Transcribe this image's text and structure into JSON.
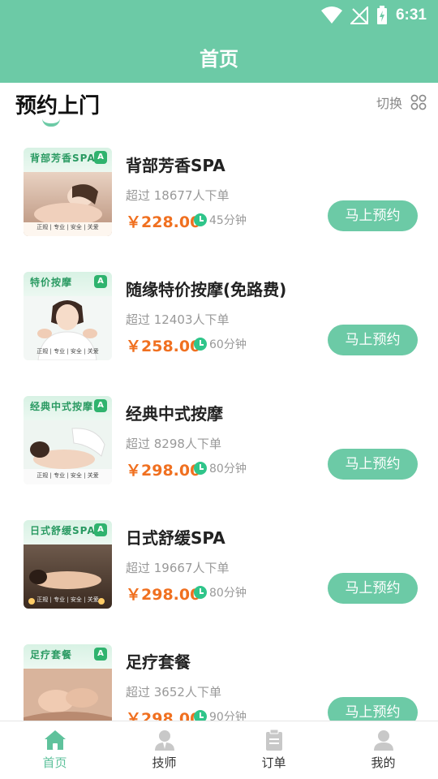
{
  "status_bar": {
    "time": "6:31"
  },
  "header": {
    "title": "首页"
  },
  "section": {
    "title": "预约上门",
    "switch_label": "切换"
  },
  "services": [
    {
      "name": "背部芳香SPA",
      "orders": "超过 18677人下单",
      "price": "￥228.00",
      "duration": "45分钟",
      "button": "马上预约",
      "thumb_title": "背部芳香SPA",
      "thumb_tags": "正规 | 专业 | 安全 | 关爱"
    },
    {
      "name": "随缘特价按摩(免路费)",
      "orders": "超过 12403人下单",
      "price": "￥258.00",
      "duration": "60分钟",
      "button": "马上预约",
      "thumb_title": "特价按摩",
      "thumb_tags": "正规 | 专业 | 安全 | 关爱"
    },
    {
      "name": "经典中式按摩",
      "orders": "超过 8298人下单",
      "price": "￥298.00",
      "duration": "80分钟",
      "button": "马上预约",
      "thumb_title": "经典中式按摩",
      "thumb_tags": "正规 | 专业 | 安全 | 关爱"
    },
    {
      "name": "日式舒缓SPA",
      "orders": "超过 19667人下单",
      "price": "￥298.00",
      "duration": "80分钟",
      "button": "马上预约",
      "thumb_title": "日式舒缓SPA",
      "thumb_tags": "正规 | 专业 | 安全 | 关爱"
    },
    {
      "name": "足疗套餐",
      "orders": "超过 3652人下单",
      "price": "￥298.00",
      "duration": "90分钟",
      "button": "马上预约",
      "thumb_title": "足疗套餐",
      "thumb_tags": ""
    }
  ],
  "tabbar": [
    {
      "label": "首页",
      "icon": "home-icon",
      "active": true
    },
    {
      "label": "技师",
      "icon": "technician-icon",
      "active": false
    },
    {
      "label": "订单",
      "icon": "order-icon",
      "active": false
    },
    {
      "label": "我的",
      "icon": "profile-icon",
      "active": false
    }
  ],
  "colors": {
    "primary": "#6ccaa6",
    "price": "#f07020",
    "clock": "#2fc58a",
    "thumb_accent": "#2a9a62"
  }
}
